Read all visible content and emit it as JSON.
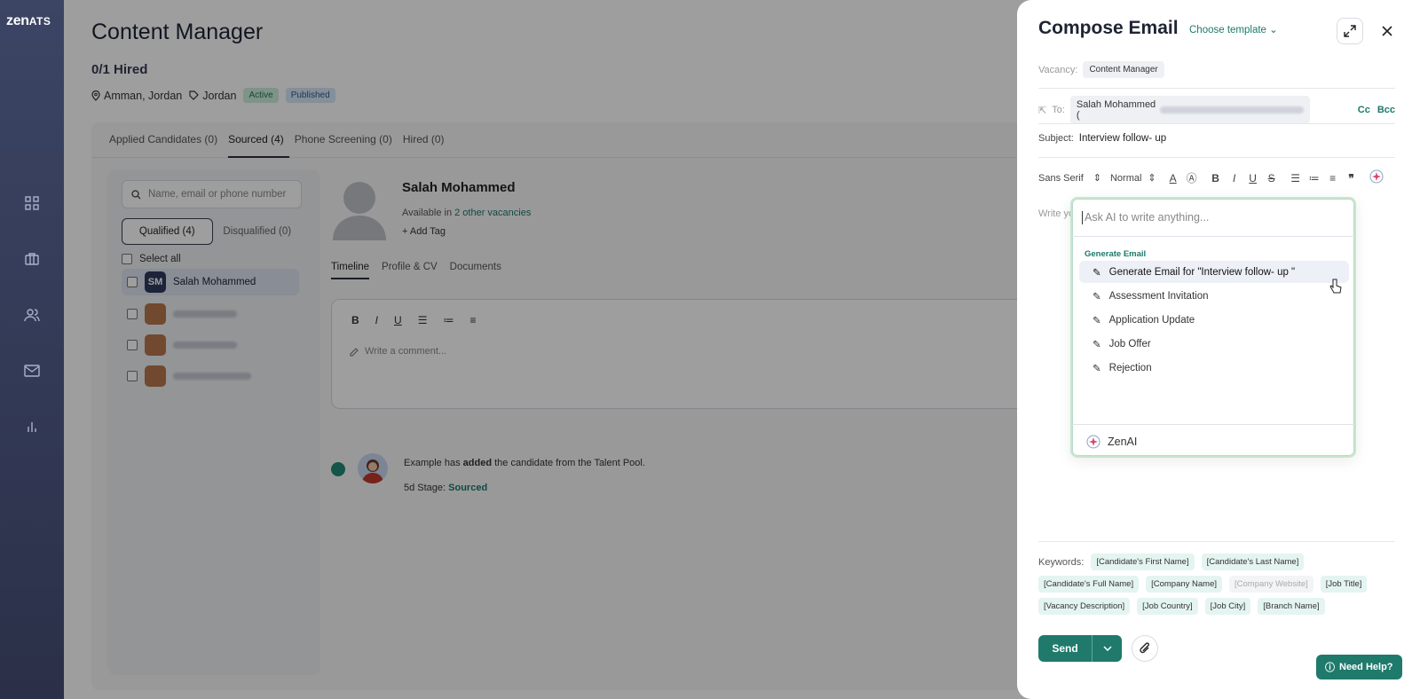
{
  "nav": {
    "logo": "zen",
    "logo_suffix": "ATS",
    "icons": [
      "grid-icon",
      "briefcase-icon",
      "users-icon",
      "mail-icon",
      "chart-icon"
    ]
  },
  "page": {
    "title": "Content Manager",
    "hired": "0/1 Hired",
    "location": "Amman, Jordan",
    "tag": "Jordan",
    "badge_active": "Active",
    "badge_published": "Published",
    "tabs": [
      "Applied Candidates (0)",
      "Sourced (4)",
      "Phone Screening (0)",
      "Hired (0)"
    ],
    "search_placeholder": "Name, email or phone number",
    "seg_qualified": "Qualified (4)",
    "seg_disqualified": "Disqualified (0)",
    "select_all": "Select all",
    "candidate_initials": "SM",
    "candidate_name": "Salah Mohammed",
    "available_prefix": "Available in",
    "available_link": "2 other vacancies",
    "add_tag": "Add Tag",
    "subtabs": [
      "Timeline",
      "Profile & CV",
      "Documents"
    ],
    "editor_placeholder": "Write a comment...",
    "timeline_text_prefix": "Example has",
    "timeline_text_bold": "added",
    "timeline_text_suffix": "the candidate from the Talent Pool.",
    "stage_prefix": "5d Stage:",
    "stage_value": "Sourced"
  },
  "drawer": {
    "title": "Compose Email",
    "choose_template": "Choose template",
    "vacancy_label": "Vacancy:",
    "vacancy_value": "Content Manager",
    "to_label": "To:",
    "to_name": "Salah Mohammed (",
    "cc": "Cc",
    "bcc": "Bcc",
    "subject_label": "Subject:",
    "subject_value": "Interview follow- up",
    "font_family": "Sans Serif",
    "font_size": "Normal",
    "body_placeholder": "Write yo",
    "ai": {
      "placeholder": "Ask AI to write anything...",
      "group": "Generate Email",
      "items": [
        "Generate Email for \"Interview follow- up \"",
        "Assessment Invitation",
        "Application Update",
        "Job Offer",
        "Rejection"
      ],
      "footer": "ZenAI"
    },
    "keywords_label": "Keywords:",
    "keywords": [
      "[Candidate's First Name]",
      "[Candidate's Last Name]",
      "[Candidate's Full Name]",
      "[Company Name]",
      "[Company Website]",
      "[Job Title]",
      "[Vacancy Description]",
      "[Job Country]",
      "[Job City]",
      "[Branch Name]"
    ],
    "send": "Send",
    "need_help": "Need Help?"
  },
  "colors": {
    "accent": "#1f7a6b",
    "nav_top": "#3c4565",
    "nav_bottom": "#2b3048"
  }
}
